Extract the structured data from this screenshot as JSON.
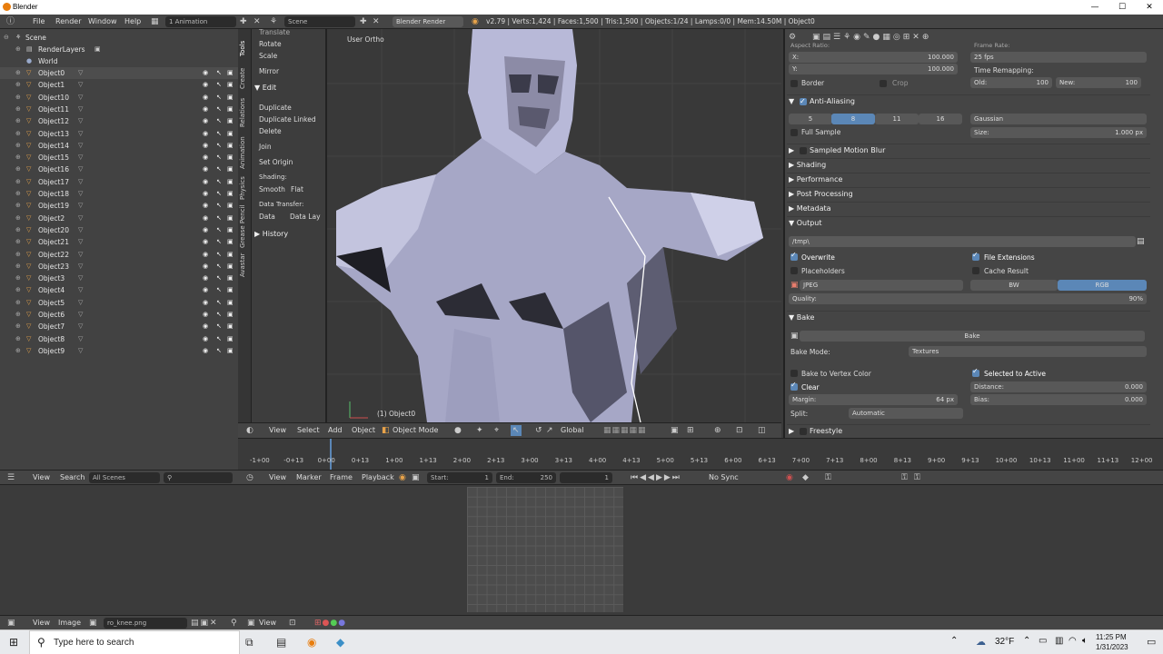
{
  "window": {
    "title": "Blender"
  },
  "info_header": {
    "menus": [
      "File",
      "Render",
      "Window",
      "Help"
    ],
    "screen_layout": "1 Animation",
    "scene": "Scene",
    "engine": "Blender Render",
    "stats": "v2.79 | Verts:1,424 | Faces:1,500 | Tris:1,500 | Objects:1/24 | Lamps:0/0 | Mem:14.50M | Object0"
  },
  "outliner": {
    "scene": "Scene",
    "render_layers": "RenderLayers",
    "world": "World",
    "objects": [
      "Object0",
      "Object1",
      "Object10",
      "Object11",
      "Object12",
      "Object13",
      "Object14",
      "Object15",
      "Object16",
      "Object17",
      "Object18",
      "Object19",
      "Object2",
      "Object20",
      "Object21",
      "Object22",
      "Object23",
      "Object3",
      "Object4",
      "Object5",
      "Object6",
      "Object7",
      "Object8",
      "Object9"
    ]
  },
  "tool_shelf": {
    "tabs": [
      "Tools",
      "Create",
      "Relations",
      "Animation",
      "Physics",
      "Grease Pencil",
      "Avastar"
    ],
    "transform": [
      "Translate",
      "Rotate",
      "Scale"
    ],
    "mirror": "Mirror",
    "edit_header": "Edit",
    "edit": [
      "Duplicate",
      "Duplicate Linked",
      "Delete"
    ],
    "join": "Join",
    "set_origin": "Set Origin",
    "shading_label": "Shading:",
    "shading_smooth": "Smooth",
    "shading_flat": "Flat",
    "data_transfer_label": "Data Transfer:",
    "data": "Data",
    "data_lay": "Data Lay",
    "history": "History"
  },
  "viewport": {
    "view_label": "User Ortho",
    "object_label": "(1) Object0",
    "header_menus": [
      "View",
      "Select",
      "Add",
      "Object"
    ],
    "mode": "Object Mode",
    "orientation": "Global"
  },
  "properties": {
    "aspect_label": "Aspect Ratio:",
    "x_label": "X:",
    "x_value": "100.000",
    "y_label": "Y:",
    "y_value": "100.000",
    "frame_rate_label": "Frame Rate:",
    "fps": "25 fps",
    "time_remap": "Time Remapping:",
    "old_label": "Old:",
    "old_value": "100",
    "new_label": "New:",
    "new_value": "100",
    "border": "Border",
    "crop": "Crop",
    "anti_aliasing": "Anti-Aliasing",
    "aa_samples": [
      "5",
      "8",
      "11",
      "16"
    ],
    "aa_filter": "Gaussian",
    "full_sample": "Full Sample",
    "size_label": "Size:",
    "size_value": "1.000 px",
    "sections": [
      "Sampled Motion Blur",
      "Shading",
      "Performance",
      "Post Processing",
      "Metadata"
    ],
    "output": "Output",
    "output_path": "/tmp\\",
    "overwrite": "Overwrite",
    "file_extensions": "File Extensions",
    "placeholders": "Placeholders",
    "cache_result": "Cache Result",
    "format": "JPEG",
    "bw": "BW",
    "rgb": "RGB",
    "quality_label": "Quality:",
    "quality_value": "90%",
    "bake": "Bake",
    "bake_button": "Bake",
    "bake_mode_label": "Bake Mode:",
    "bake_mode": "Textures",
    "bake_vertex": "Bake to Vertex Color",
    "selected_active": "Selected to Active",
    "clear": "Clear",
    "distance_label": "Distance:",
    "distance_value": "0.000",
    "margin_label": "Margin:",
    "margin_value": "64 px",
    "bias_label": "Bias:",
    "bias_value": "0.000",
    "split_label": "Split:",
    "split_value": "Automatic",
    "freestyle": "Freestyle"
  },
  "timeline": {
    "ticks": [
      "-1+00",
      "-0+13",
      "0+00",
      "0+13",
      "1+00",
      "1+13",
      "2+00",
      "2+13",
      "3+00",
      "3+13",
      "4+00",
      "4+13",
      "5+00",
      "5+13",
      "6+00",
      "6+13",
      "7+00",
      "7+13",
      "8+00",
      "8+13",
      "9+00",
      "9+13",
      "10+00",
      "10+13",
      "11+00",
      "11+13",
      "12+00"
    ],
    "menus": [
      "View",
      "Marker",
      "Frame",
      "Playback"
    ],
    "start_label": "Start:",
    "start": "1",
    "end_label": "End:",
    "end": "250",
    "current": "1",
    "sync": "No Sync"
  },
  "outliner_header": {
    "menus": [
      "View",
      "Search"
    ],
    "filter": "All Scenes"
  },
  "image_editor_header": {
    "menus": [
      "View",
      "Image"
    ],
    "image_name": "ro_knee.png",
    "view": "View"
  },
  "taskbar": {
    "search_placeholder": "Type here to search",
    "temperature": "32°F",
    "time": "11:25 PM",
    "date": "1/31/2023"
  }
}
